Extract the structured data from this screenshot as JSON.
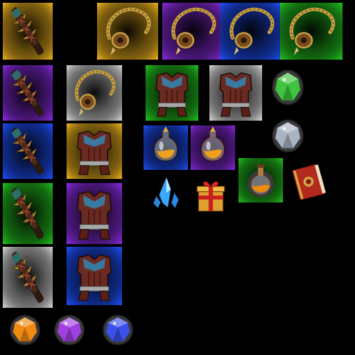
{
  "sheet": {
    "background": "#000000",
    "rarity_colors": {
      "gold": "#f0b41e",
      "purple": "#8a2be2",
      "blue": "#1e50ff",
      "green": "#22c51e",
      "white": "#d8d8d8",
      "none": "#000000"
    },
    "sprites": [
      {
        "name": "spiked-club-icon",
        "item": "spiked-club",
        "rarity": "gold"
      },
      {
        "name": "rope-amulet-icon",
        "item": "rope-amulet",
        "rarity": "gold"
      },
      {
        "name": "rope-amulet-icon",
        "item": "rope-amulet",
        "rarity": "purple"
      },
      {
        "name": "rope-amulet-icon",
        "item": "rope-amulet",
        "rarity": "blue"
      },
      {
        "name": "rope-amulet-icon",
        "item": "rope-amulet",
        "rarity": "green"
      },
      {
        "name": "spiked-club-icon",
        "item": "spiked-club",
        "rarity": "purple"
      },
      {
        "name": "rope-amulet-icon",
        "item": "rope-amulet",
        "rarity": "white"
      },
      {
        "name": "leather-armor-icon",
        "item": "leather-armor",
        "rarity": "green"
      },
      {
        "name": "leather-armor-icon",
        "item": "leather-armor",
        "rarity": "white"
      },
      {
        "name": "green-gem-icon",
        "item": "gem",
        "rarity": "none",
        "gem_color": "#3ec43e"
      },
      {
        "name": "spiked-club-icon",
        "item": "spiked-club",
        "rarity": "blue"
      },
      {
        "name": "leather-armor-icon",
        "item": "leather-armor",
        "rarity": "gold"
      },
      {
        "name": "health-potion-icon",
        "item": "potion",
        "rarity": "blue"
      },
      {
        "name": "health-potion-icon",
        "item": "potion",
        "rarity": "purple"
      },
      {
        "name": "silver-gem-icon",
        "item": "gem",
        "rarity": "none",
        "gem_color": "#a9b4c2"
      },
      {
        "name": "spiked-club-icon",
        "item": "spiked-club",
        "rarity": "green"
      },
      {
        "name": "leather-armor-icon",
        "item": "leather-armor",
        "rarity": "purple"
      },
      {
        "name": "round-potion-icon",
        "item": "round-potion",
        "rarity": "green"
      },
      {
        "name": "red-book-icon",
        "item": "book",
        "rarity": "none"
      },
      {
        "name": "mana-crystal-icon",
        "item": "crystal",
        "rarity": "none"
      },
      {
        "name": "gift-box-icon",
        "item": "gift",
        "rarity": "none"
      },
      {
        "name": "spiked-club-icon",
        "item": "spiked-club",
        "rarity": "white"
      },
      {
        "name": "leather-armor-icon",
        "item": "leather-armor",
        "rarity": "blue"
      },
      {
        "name": "orange-gem-icon",
        "item": "gem",
        "rarity": "none",
        "gem_color": "#f08a10"
      },
      {
        "name": "purple-gem-icon",
        "item": "gem",
        "rarity": "none",
        "gem_color": "#a040e0"
      },
      {
        "name": "blue-gem-icon",
        "item": "gem",
        "rarity": "none",
        "gem_color": "#3a50e8"
      }
    ]
  }
}
